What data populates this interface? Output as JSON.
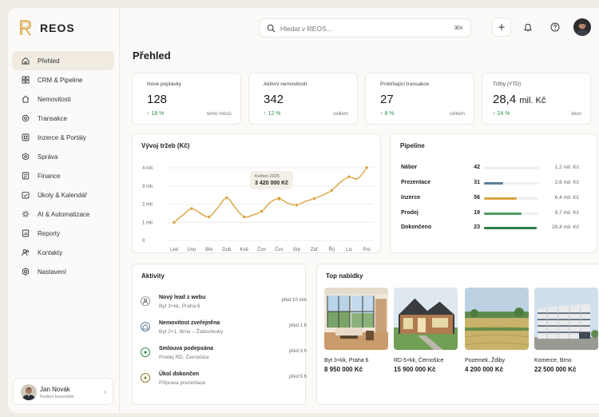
{
  "app": {
    "name": "REOS"
  },
  "colors": {
    "accent": "#d8a23d",
    "positive": "#2f8f4e",
    "blue": "#5b7f9a",
    "green": "#4e9b64",
    "dark_green": "#2f7d4b"
  },
  "search": {
    "placeholder": "Hledat v REOS...",
    "shortcut": "⌘K"
  },
  "header": {
    "add_label": "+",
    "icons": [
      "bell-icon",
      "help-icon"
    ]
  },
  "sidebar": {
    "items": [
      {
        "label": "Přehled",
        "icon": "home-icon",
        "active": true
      },
      {
        "label": "CRM & Pipeline",
        "icon": "crm-icon"
      },
      {
        "label": "Nemovitosti",
        "icon": "house-icon"
      },
      {
        "label": "Transakce",
        "icon": "transaction-icon"
      },
      {
        "label": "Inzerce & Portály",
        "icon": "listing-icon"
      },
      {
        "label": "Správa",
        "icon": "management-icon"
      },
      {
        "label": "Finance",
        "icon": "finance-icon"
      },
      {
        "label": "Úkoly & Kalendář",
        "icon": "calendar-icon"
      },
      {
        "label": "AI & Automatizace",
        "icon": "ai-icon"
      },
      {
        "label": "Reporty",
        "icon": "report-icon"
      },
      {
        "label": "Kontakty",
        "icon": "contacts-icon"
      },
      {
        "label": "Nastavení",
        "icon": "settings-icon"
      }
    ],
    "user": {
      "name": "Jan Novák",
      "role": "Ředitel kanceláře"
    }
  },
  "page": {
    "title": "Přehled"
  },
  "kpis": [
    {
      "label": "Nové poptávky",
      "value": "128",
      "unit": "",
      "delta": "↑ 18 %",
      "note": "tento měsíc"
    },
    {
      "label": "Aktivní nemovitosti",
      "value": "342",
      "unit": "",
      "delta": "↑ 12 %",
      "note": "celkem"
    },
    {
      "label": "Probíhající transakce",
      "value": "27",
      "unit": "",
      "delta": "↑ 8 %",
      "note": "celkem"
    },
    {
      "label": "Tržby (YTD)",
      "value": "28,4",
      "unit": "mil. Kč",
      "delta": "↑ 24 %",
      "note": "letos"
    }
  ],
  "revenue": {
    "title": "Vývoj tržeb (Kč)",
    "tooltip": {
      "label": "Květen 2025",
      "value": "3 420 000 Kč"
    }
  },
  "chart_data": {
    "type": "line",
    "title": "Vývoj tržeb (Kč)",
    "categories": [
      "Led",
      "Úno",
      "Bře",
      "Dub",
      "Kvě",
      "Čvn",
      "Čvc",
      "Srp",
      "Zář",
      "Říj",
      "Lis",
      "Pro"
    ],
    "x": [
      0,
      0.5,
      1,
      1.5,
      2,
      2.5,
      3,
      3.5,
      4,
      4.5,
      5,
      5.5,
      6,
      6.5,
      7,
      7.5,
      8,
      8.5,
      9,
      9.5,
      10,
      10.5,
      11
    ],
    "y": [
      1.0,
      1.4,
      1.75,
      1.5,
      1.3,
      1.8,
      2.35,
      1.8,
      1.3,
      1.4,
      1.6,
      2.1,
      2.3,
      2.05,
      1.95,
      2.15,
      2.3,
      2.5,
      2.75,
      3.2,
      3.5,
      3.4,
      4.0
    ],
    "markers": [
      0,
      2,
      4,
      6,
      8,
      10,
      12,
      14,
      16,
      18,
      20,
      22
    ],
    "highlight": 12,
    "yticks": [
      0,
      1,
      2,
      3,
      4
    ],
    "ytick_labels": [
      "0",
      "1 mil.",
      "2 mil.",
      "3 mil.",
      "4 mil."
    ],
    "ylim": [
      0,
      4
    ],
    "color": "#d8a23d",
    "grid": true,
    "xlabel": "",
    "ylabel": ""
  },
  "pipeline": {
    "title": "Pipeline",
    "rows": [
      {
        "label": "Nábor",
        "count": "42",
        "amount": "1,2 mil. Kč",
        "fill": 0,
        "color": "#d8a23d"
      },
      {
        "label": "Prezentace",
        "count": "31",
        "amount": "2,6 mil. Kč",
        "fill": 0.35,
        "color": "#5b7f9a"
      },
      {
        "label": "Inzerce",
        "count": "56",
        "amount": "6,4 mil. Kč",
        "fill": 0.6,
        "color": "#d8a23d"
      },
      {
        "label": "Prodej",
        "count": "19",
        "amount": "9,7 mil. Kč",
        "fill": 0.68,
        "color": "#4e9b64"
      },
      {
        "label": "Dokončeno",
        "count": "23",
        "amount": "28,4 mil. Kč",
        "fill": 0.95,
        "color": "#2f7d4b"
      }
    ]
  },
  "activities": {
    "title": "Aktivity",
    "items": [
      {
        "title": "Nový lead z webu",
        "sub": "Byt 3+kk, Praha 6",
        "time": "před 10 min",
        "icon": "user-icon"
      },
      {
        "title": "Nemovitost zveřejněna",
        "sub": "Byt 2+1, Brno – Žabovřesky",
        "time": "před 1 h",
        "icon": "home-icon"
      },
      {
        "title": "Smlouva podepsána",
        "sub": "Prodej RD, Černošice",
        "time": "před 3 h",
        "icon": "check-icon"
      },
      {
        "title": "Úkol dokončen",
        "sub": "Příprava prezentace",
        "time": "před 5 h",
        "icon": "check-icon"
      }
    ]
  },
  "offers": {
    "title": "Top nabídky",
    "items": [
      {
        "name": "Byt 3+kk, Praha 6",
        "price": "8 950 000 Kč"
      },
      {
        "name": "RD 5+kk, Černošice",
        "price": "15 900 000 Kč"
      },
      {
        "name": "Pozemek, Ždiby",
        "price": "4 200 000 Kč"
      },
      {
        "name": "Komerce, Brno",
        "price": "22 500 000 Kč"
      }
    ]
  }
}
